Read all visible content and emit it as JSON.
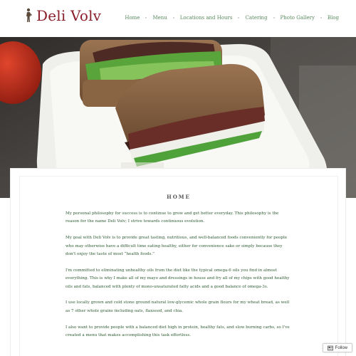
{
  "site": {
    "logo_text": "Deli Volv",
    "logo_icon": "figure-icon",
    "brand_color": "#8b1e2b",
    "link_color": "#5a8a5e"
  },
  "nav": {
    "items": [
      {
        "label": "Home"
      },
      {
        "label": "Menu"
      },
      {
        "label": "Locations and Hours"
      },
      {
        "label": "Catering"
      },
      {
        "label": "Photo Gallery"
      },
      {
        "label": "Blog"
      }
    ]
  },
  "hero": {
    "image": "sandwich-photo"
  },
  "page": {
    "title": "HOME",
    "paragraphs": [
      "My personal philosophy for success is to continue to grow and get better everyday.  This philosophy is the reason for the name Deli Volv; I strive towards continuous evolution.",
      "My goal with Deli Volv is to provide great tasting, nutritious, and well-balanced foods conveniently for people who may otherwise have a difficult time eating healthy, either for convenience sake or simply because they don't enjoy the taste of most “health foods.”",
      "I'm committed to eliminating unhealthy oils from the diet like the typical omega-6 oils you find in almost everything.  This is why I make all of my mayo and dressings in house and fry all of my chips with good healthy oils and fats, balanced with plenty of mono-unsaturated fatty acids and a good balance of omega-3s.",
      "I use locally grown and cold stone ground natural low-glycemic whole grain flours for my wheat bread, as well as 7 other whole grains including oats, flaxseed, and chia.",
      "I also want to provide people with a balanced diet high in protein, healthy fats, and slow burning carbs, so I've created a menu that makes accomplishing this task effortless."
    ]
  },
  "follow": {
    "label": "Follow",
    "icon": "follow-icon"
  }
}
